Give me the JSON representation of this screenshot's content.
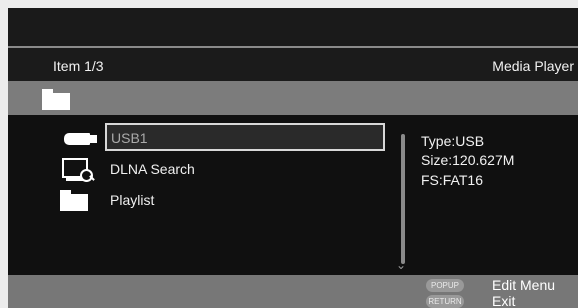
{
  "header": {
    "item_counter": "Item 1/3",
    "screen_title": "Media Player"
  },
  "list": {
    "items": [
      {
        "label": "USB1",
        "icon": "usb-drive-icon",
        "selected": true
      },
      {
        "label": "DLNA Search",
        "icon": "dlna-search-icon",
        "selected": false
      },
      {
        "label": "Playlist",
        "icon": "folder-icon",
        "selected": false
      }
    ]
  },
  "info": {
    "type": "Type:USB",
    "size": "Size:120.627M",
    "fs": "FS:FAT16"
  },
  "footer": {
    "popup_key": "POPUP",
    "popup_action": "Edit Menu",
    "return_key": "RETURN",
    "return_action": "Exit"
  },
  "colors": {
    "selection_border": "#d8d8d8",
    "path_bar": "#7c7c7c",
    "footer": "#777777"
  }
}
